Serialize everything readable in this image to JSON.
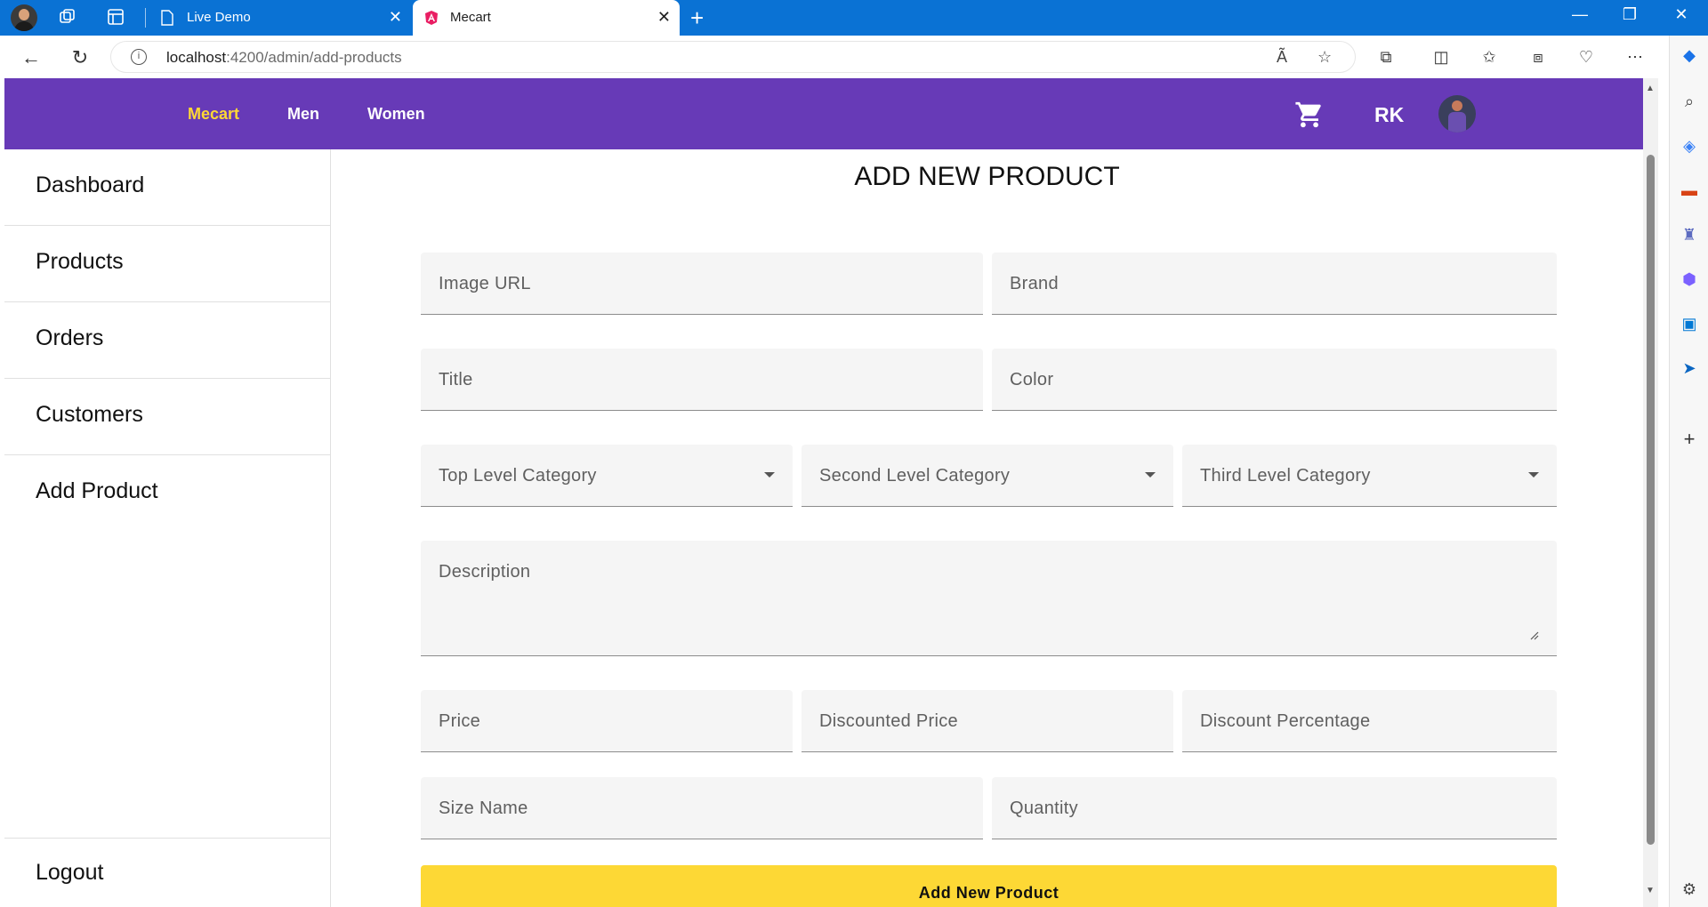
{
  "browser": {
    "tabs": [
      {
        "title": "Live Demo",
        "active": false
      },
      {
        "title": "Mecart",
        "active": true
      }
    ],
    "url_host": "localhost",
    "url_path": ":4200/admin/add-products"
  },
  "navbar": {
    "brand": "Mecart",
    "links": [
      "Men",
      "Women"
    ],
    "user_initials": "RK",
    "colors": {
      "background": "#673ab7",
      "brand": "#fdd835"
    }
  },
  "sidebar": {
    "items": [
      {
        "label": "Dashboard"
      },
      {
        "label": "Products"
      },
      {
        "label": "Orders"
      },
      {
        "label": "Customers"
      },
      {
        "label": "Add Product"
      }
    ],
    "logout": "Logout"
  },
  "form": {
    "title": "ADD NEW PRODUCT",
    "image_url": "Image URL",
    "brand": "Brand",
    "title_field": "Title",
    "color": "Color",
    "top_category": "Top Level Category",
    "second_category": "Second Level Category",
    "third_category": "Third Level Category",
    "description": "Description",
    "price": "Price",
    "discounted_price": "Discounted Price",
    "discount_percentage": "Discount Percentage",
    "size_name": "Size Name",
    "quantity": "Quantity",
    "submit": "Add New Product",
    "submit_color": "#fdd835"
  }
}
